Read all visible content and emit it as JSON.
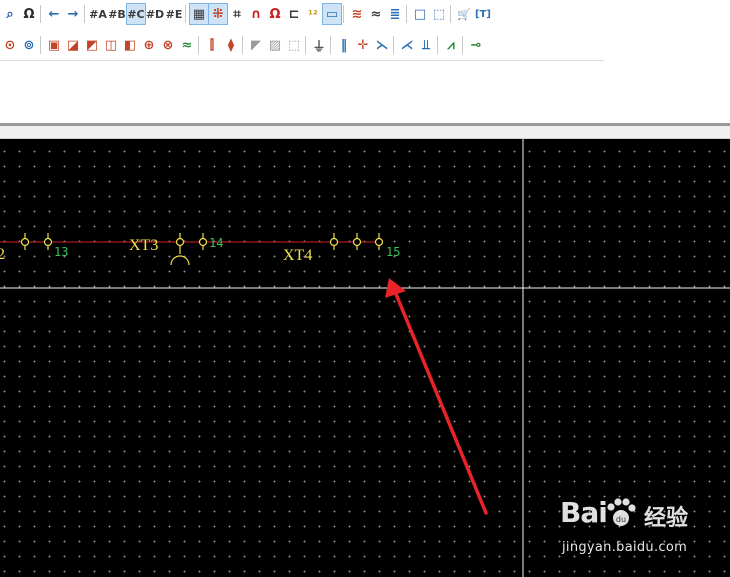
{
  "toolbar_row1": [
    {
      "name": "find-icon",
      "glyph": "⌕",
      "color": "#2a5f9e"
    },
    {
      "name": "find-replace-icon",
      "glyph": "Ω",
      "color": "#2a2a2a"
    },
    {
      "sep": true
    },
    {
      "name": "back-arrow-icon",
      "glyph": "←",
      "color": "#2c6fb5"
    },
    {
      "name": "forward-arrow-icon",
      "glyph": "→",
      "color": "#2c6fb5"
    },
    {
      "sep": true
    },
    {
      "name": "grid-a-icon",
      "glyph": "#A",
      "color": "#3a3a3a"
    },
    {
      "name": "grid-b-icon",
      "glyph": "#B",
      "color": "#3a3a3a"
    },
    {
      "name": "grid-c-icon",
      "glyph": "#C",
      "color": "#3a3a3a",
      "active": true
    },
    {
      "name": "grid-d-icon",
      "glyph": "#D",
      "color": "#3a3a3a"
    },
    {
      "name": "grid-e-icon",
      "glyph": "#E",
      "color": "#3a3a3a"
    },
    {
      "sep": true
    },
    {
      "name": "grid-toggle-icon",
      "glyph": "▦",
      "color": "#3a3a3a",
      "active": true
    },
    {
      "name": "snap-grid-icon",
      "glyph": "⁜",
      "color": "#c4462a",
      "active": true
    },
    {
      "name": "crosshair-icon",
      "glyph": "⌗",
      "color": "#3a3a3a"
    },
    {
      "name": "magnet-icon",
      "glyph": "∩",
      "color": "#c8201e"
    },
    {
      "name": "magnet-object-icon",
      "glyph": "Ω",
      "color": "#c8201e"
    },
    {
      "name": "snap-connect-icon",
      "glyph": "⊏",
      "color": "#3a3a3a"
    },
    {
      "name": "numbering-icon",
      "glyph": "¹²",
      "color": "#c89a1a"
    },
    {
      "name": "ruler-icon",
      "glyph": "▭",
      "color": "#2c6fb5",
      "active": true
    },
    {
      "sep": true
    },
    {
      "name": "wire-lines-icon",
      "glyph": "≋",
      "color": "#c4462a"
    },
    {
      "name": "wire-curve-icon",
      "glyph": "≈",
      "color": "#3a3a3a"
    },
    {
      "name": "wire-bundle-icon",
      "glyph": "≣",
      "color": "#2c6fb5"
    },
    {
      "sep": true
    },
    {
      "name": "select-small-icon",
      "glyph": "□",
      "color": "#2c6fb5"
    },
    {
      "name": "select-area-icon",
      "glyph": "⬚",
      "color": "#2c6fb5"
    },
    {
      "sep": true
    },
    {
      "name": "cart-icon",
      "glyph": "🛒",
      "color": "#2c6fb5"
    },
    {
      "name": "text-tool-icon",
      "glyph": "[T]",
      "color": "#2c6fb5"
    }
  ],
  "toolbar_row2": [
    {
      "name": "symbol-a-icon",
      "glyph": "⊙",
      "color": "#c4462a"
    },
    {
      "name": "symbol-b-icon",
      "glyph": "⊚",
      "color": "#2c6fb5"
    },
    {
      "sep": true
    },
    {
      "name": "device-icon",
      "glyph": "▣",
      "color": "#c4462a"
    },
    {
      "name": "device-tag-icon",
      "glyph": "◪",
      "color": "#c4462a"
    },
    {
      "name": "device-filter-icon",
      "glyph": "◩",
      "color": "#c4462a"
    },
    {
      "name": "device-insert-icon",
      "glyph": "◫",
      "color": "#c4462a"
    },
    {
      "name": "device-link-icon",
      "glyph": "◧",
      "color": "#c4462a"
    },
    {
      "name": "terminal-icon",
      "glyph": "⊕",
      "color": "#c4462a"
    },
    {
      "name": "terminal-alt-icon",
      "glyph": "⊗",
      "color": "#c4462a"
    },
    {
      "name": "cable-icon",
      "glyph": "≈",
      "color": "#2a8a3a"
    },
    {
      "sep": true
    },
    {
      "name": "connector-icon",
      "glyph": "⫿",
      "color": "#c4462a"
    },
    {
      "name": "connector-alt-icon",
      "glyph": "⧫",
      "color": "#c4462a"
    },
    {
      "sep": true
    },
    {
      "name": "fill-icon",
      "glyph": "◤",
      "color": "#999999"
    },
    {
      "name": "hatch-icon",
      "glyph": "▨",
      "color": "#999999"
    },
    {
      "name": "dotted-box-icon",
      "glyph": "⬚",
      "color": "#999999"
    },
    {
      "sep": true
    },
    {
      "name": "ground-icon",
      "glyph": "⏚",
      "color": "#555555"
    },
    {
      "sep": true
    },
    {
      "name": "wire-break-icon",
      "glyph": "‖",
      "color": "#2c6fb5"
    },
    {
      "name": "wire-cross-icon",
      "glyph": "✛",
      "color": "#c4462a"
    },
    {
      "name": "wire-junction-icon",
      "glyph": "⋋",
      "color": "#2c6fb5"
    },
    {
      "sep": true
    },
    {
      "name": "wire-angle-icon",
      "glyph": "⋌",
      "color": "#2c6fb5"
    },
    {
      "name": "wire-tee-icon",
      "glyph": "⫫",
      "color": "#2c6fb5"
    },
    {
      "sep": true
    },
    {
      "name": "wire-diag-icon",
      "glyph": "⩘",
      "color": "#2a8a3a"
    },
    {
      "sep": true
    },
    {
      "name": "wire-jump-icon",
      "glyph": "⊸",
      "color": "#2a8a3a"
    }
  ],
  "schematic": {
    "labels": {
      "device_partial": "2",
      "xt3": "XT3",
      "xt4": "XT4",
      "pin_13": "13",
      "pin_14": "14",
      "pin_15": "15"
    },
    "colors": {
      "background": "#000000",
      "wire": "#d21e1e",
      "symbol": "#f2e24a",
      "pin_number": "#36c25a",
      "crosshair": "#f2f2f2",
      "arrow": "#e8232a"
    }
  },
  "watermark": {
    "logo": "Bai",
    "logo_suffix": "经验",
    "url": "jingyan.baidu.com"
  }
}
